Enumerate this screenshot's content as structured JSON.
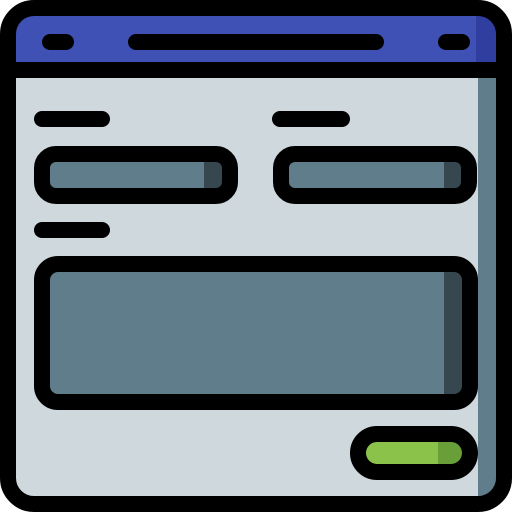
{
  "icon": {
    "name": "web-form-window-icon",
    "colors": {
      "outline": "#000000",
      "titlebar": "#3F51B5",
      "titlebar_shade": "#303F9F",
      "window_body": "#CFD8DC",
      "window_shade": "#607D8B",
      "field_fill": "#607D8B",
      "field_shade": "#37474F",
      "submit_fill": "#8BC34A",
      "submit_shade": "#689F38"
    },
    "titlebar": {
      "title_placeholder": true,
      "controls": [
        "left-dot",
        "right-dot"
      ]
    },
    "form": {
      "fields": [
        {
          "id": "field-left",
          "type": "text-input",
          "label_placeholder": true
        },
        {
          "id": "field-right",
          "type": "text-input",
          "label_placeholder": true
        },
        {
          "id": "field-textarea",
          "type": "textarea",
          "label_placeholder": true
        }
      ],
      "submit_button": {
        "label_placeholder": false
      }
    }
  }
}
